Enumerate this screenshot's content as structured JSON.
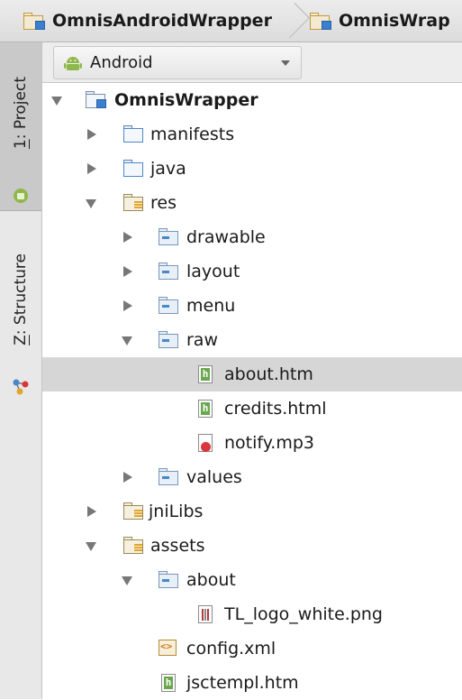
{
  "breadcrumb": {
    "items": [
      "OmnisAndroidWrapper",
      "OmnisWrap"
    ]
  },
  "toolstrip": {
    "project_prefix": "1",
    "project_label": ": Project",
    "structure_prefix": "Z",
    "structure_label": ": Structure"
  },
  "view_selector": {
    "value": "Android"
  },
  "tree": {
    "nodes": [
      {
        "label": "OmnisWrapper",
        "icon": "module-folder-icon",
        "expanded": true
      },
      {
        "label": "manifests",
        "icon": "folder-icon",
        "expanded": false
      },
      {
        "label": "java",
        "icon": "folder-icon",
        "expanded": false
      },
      {
        "label": "res",
        "icon": "resource-folder-icon",
        "expanded": true
      },
      {
        "label": "drawable",
        "icon": "folder-icon",
        "expanded": false
      },
      {
        "label": "layout",
        "icon": "folder-icon",
        "expanded": false
      },
      {
        "label": "menu",
        "icon": "folder-icon",
        "expanded": false
      },
      {
        "label": "raw",
        "icon": "folder-icon",
        "expanded": true
      },
      {
        "label": "about.htm",
        "icon": "html-file-icon",
        "selected": true
      },
      {
        "label": "credits.html",
        "icon": "html-file-icon"
      },
      {
        "label": "notify.mp3",
        "icon": "audio-file-icon"
      },
      {
        "label": "values",
        "icon": "folder-icon",
        "expanded": false
      },
      {
        "label": "jniLibs",
        "icon": "resource-folder-icon",
        "expanded": false
      },
      {
        "label": "assets",
        "icon": "resource-folder-icon",
        "expanded": true
      },
      {
        "label": "about",
        "icon": "folder-icon",
        "expanded": true
      },
      {
        "label": "TL_logo_white.png",
        "icon": "image-file-icon"
      },
      {
        "label": "config.xml",
        "icon": "xml-file-icon"
      },
      {
        "label": "jsctempl.htm",
        "icon": "html-file-icon"
      }
    ]
  },
  "colors": {
    "selection": "#d6d6d6",
    "strip": "#e8e8e8",
    "folder_blue": "#4f87c4"
  }
}
